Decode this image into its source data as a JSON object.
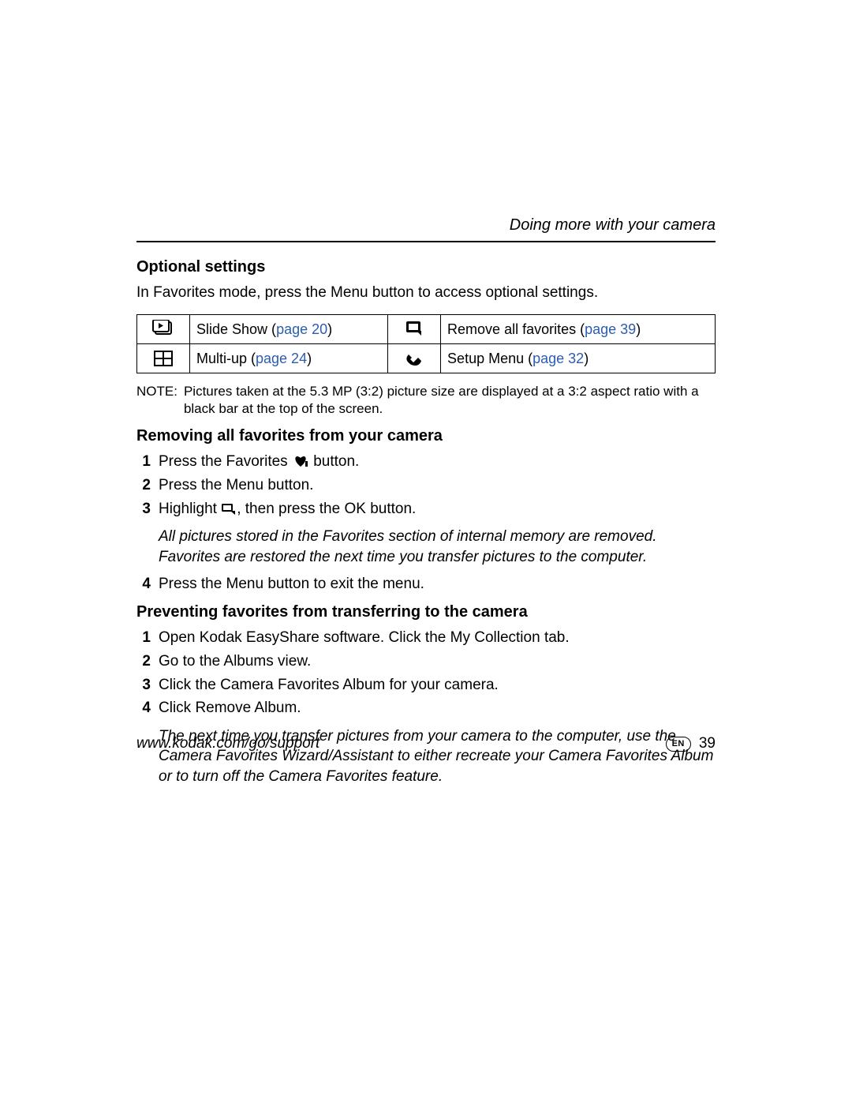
{
  "running_head": "Doing more with your camera",
  "sections": {
    "optional": {
      "title": "Optional settings",
      "intro": "In Favorites mode, press the Menu button to access optional settings.",
      "table": {
        "r1c1": {
          "label": "Slide Show (",
          "link": "page 20",
          "tail": ")"
        },
        "r1c2": {
          "label": "Remove all favorites (",
          "link": "page 39",
          "tail": ")"
        },
        "r2c1": {
          "label": "Multi-up (",
          "link": "page 24",
          "tail": ")"
        },
        "r2c2": {
          "label": "Setup Menu (",
          "link": "page 32",
          "tail": ")"
        }
      },
      "note_label": "NOTE:",
      "note_body": "Pictures taken at the 5.3 MP (3:2) picture size are displayed at a 3:2 aspect ratio with a black bar at the top of the screen."
    },
    "removing": {
      "title": "Removing all favorites from your camera",
      "steps": {
        "s1a": "Press the Favorites ",
        "s1b": " button.",
        "s2": "Press the Menu button.",
        "s3a": "Highlight ",
        "s3b": ", then press the OK button.",
        "result": "All pictures stored in the Favorites section of internal memory are removed. Favorites are restored the next time you transfer pictures to the computer.",
        "s4": "Press the Menu button to exit the menu."
      }
    },
    "preventing": {
      "title": "Preventing favorites from transferring to the camera",
      "steps": {
        "s1": "Open Kodak EasyShare software. Click the My Collection tab.",
        "s2": "Go to the Albums view.",
        "s3": "Click the Camera Favorites Album for your camera.",
        "s4": "Click Remove Album.",
        "result": "The next time you transfer pictures from your camera to the computer, use the Camera Favorites Wizard/Assistant to either recreate your Camera Favorites Album or to turn off the Camera Favorites feature."
      }
    }
  },
  "footer": {
    "url": "www.kodak.com/go/support",
    "lang": "EN",
    "page": "39"
  },
  "nums": {
    "n1": "1",
    "n2": "2",
    "n3": "3",
    "n4": "4"
  }
}
